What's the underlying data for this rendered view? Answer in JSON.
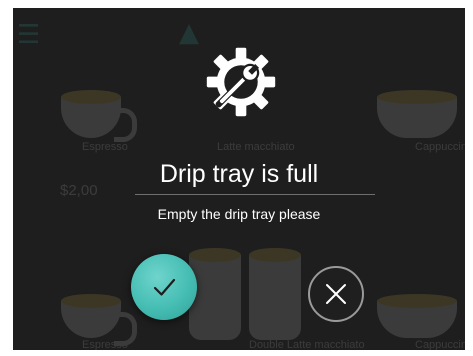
{
  "dialog": {
    "title": "Drip tray is full",
    "message": "Empty the drip tray please"
  },
  "background_menu": {
    "items": [
      {
        "label": "Espresso"
      },
      {
        "label": "Latte macchiato"
      },
      {
        "label": "Cappuccino"
      },
      {
        "label": "Espresso"
      },
      {
        "label": "Double Latte macchiato"
      },
      {
        "label": "Cappuccino"
      }
    ],
    "price": "$2,00"
  },
  "icons": {
    "dialog_icon": "gear-wrench-icon",
    "confirm": "checkmark-icon",
    "cancel": "close-icon",
    "menu": "menu-icon",
    "warning": "warning-icon"
  },
  "colors": {
    "screen_background": "#1e1e1e",
    "accent": "#45bdb3",
    "text": "#ffffff",
    "cancel_border": "#9a9a9a"
  }
}
